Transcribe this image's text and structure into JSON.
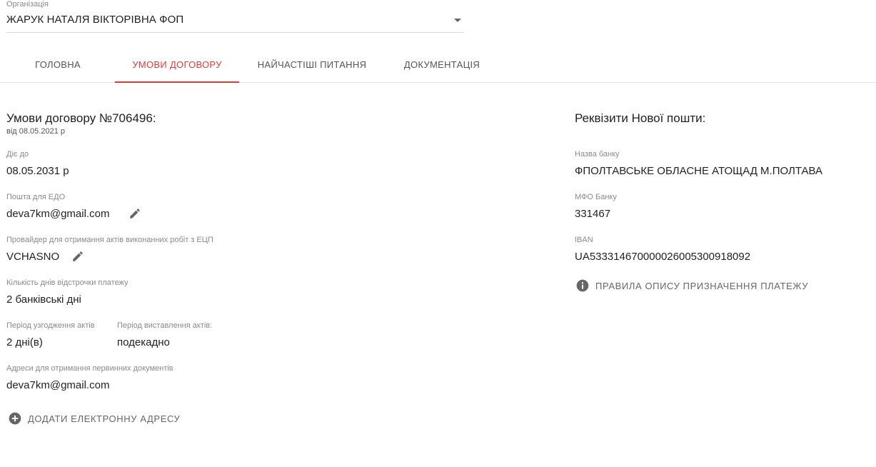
{
  "organization": {
    "label": "Організація",
    "value": "ЖАРУК НАТАЛЯ ВІКТОРІВНА ФОП"
  },
  "tabs": [
    {
      "label": "ГОЛОВНА"
    },
    {
      "label": "УМОВИ ДОГОВОРУ"
    },
    {
      "label": "НАЙЧАСТІШІ ПИТАННЯ"
    },
    {
      "label": "ДОКУМЕНТАЦІЯ"
    }
  ],
  "contract": {
    "title": "Умови договору №706496:",
    "date": "від 08.05.2021 р",
    "valid_until_label": "Діє до",
    "valid_until": "08.05.2031 р",
    "edo_email_label": "Пошта для ЕДО",
    "edo_email": "deva7km@gmail.com",
    "provider_label": "Провайдер для отримання актів виконанних робіт з ЕЦП",
    "provider": "VCHASNO",
    "deferral_label": "Кількість днів відстрочки платежу",
    "deferral": "2 банківські дні",
    "approval_period_label": "Період узгодження актів",
    "approval_period": "2 дні(в)",
    "issue_period_label": "Період виставлення актів:",
    "issue_period": "подекадно",
    "addresses_label": "Адреси для отримання первинних документів",
    "addresses": [
      "deva7km@gmail.com"
    ],
    "add_address_label": "ДОДАТИ ЕЛЕКТРОННУ АДРЕСУ"
  },
  "requisites": {
    "title": "Реквізити Нової пошти:",
    "bank_name_label": "Назва банку",
    "bank_name": "ФПОЛТАВСЬКЕ ОБЛАСНЕ АТОЩАД М.ПОЛТАВА",
    "mfo_label": "МФО Банку",
    "mfo": "331467",
    "iban_label": "IBAN",
    "iban": "UA533314670000026005300918092",
    "rules_link": "ПРАВИЛА ОПИСУ ПРИЗНАЧЕННЯ ПЛАТЕЖУ"
  },
  "icons": {
    "edit": "pencil-icon",
    "add": "add-circle-icon",
    "info": "info-icon",
    "dropdown": "caret-down-icon"
  },
  "colors": {
    "accent": "#e53935",
    "icon": "#666666",
    "caption": "#8a8a8a"
  }
}
